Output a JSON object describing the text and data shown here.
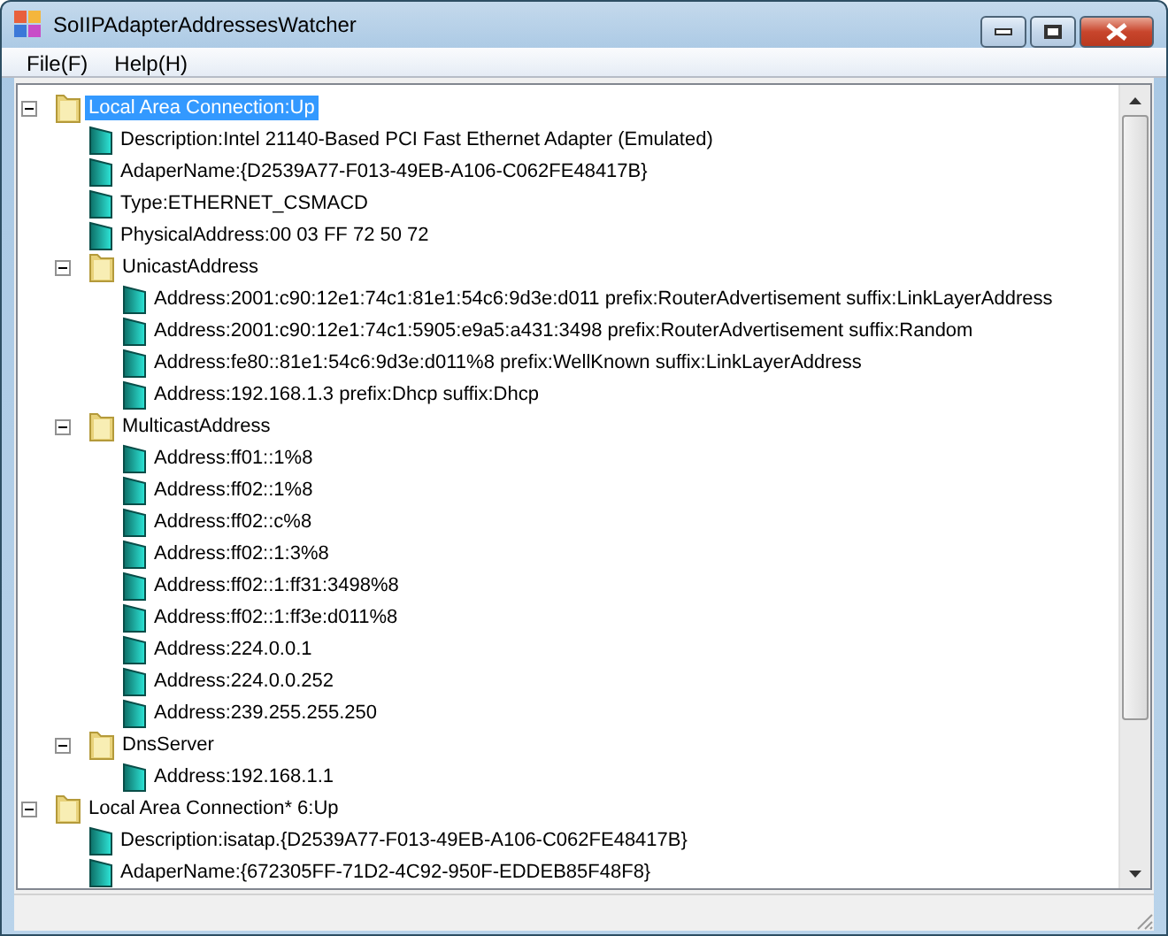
{
  "window": {
    "title": "SoIIPAdapterAddressesWatcher"
  },
  "menu": [
    "File(F)",
    "Help(H)"
  ],
  "tree": [
    {
      "kind": "folder",
      "label": "Local Area Connection:Up",
      "expanded": true,
      "selected": true,
      "children": [
        {
          "kind": "leaf",
          "label": "Description:Intel 21140-Based PCI Fast Ethernet Adapter (Emulated)"
        },
        {
          "kind": "leaf",
          "label": "AdaperName:{D2539A77-F013-49EB-A106-C062FE48417B}"
        },
        {
          "kind": "leaf",
          "label": "Type:ETHERNET_CSMACD"
        },
        {
          "kind": "leaf",
          "label": "PhysicalAddress:00 03 FF 72 50 72"
        },
        {
          "kind": "folder",
          "label": "UnicastAddress",
          "expanded": true,
          "selected": false,
          "children": [
            {
              "kind": "leaf",
              "label": "Address:2001:c90:12e1:74c1:81e1:54c6:9d3e:d011 prefix:RouterAdvertisement suffix:LinkLayerAddress"
            },
            {
              "kind": "leaf",
              "label": "Address:2001:c90:12e1:74c1:5905:e9a5:a431:3498 prefix:RouterAdvertisement suffix:Random"
            },
            {
              "kind": "leaf",
              "label": "Address:fe80::81e1:54c6:9d3e:d011%8 prefix:WellKnown suffix:LinkLayerAddress"
            },
            {
              "kind": "leaf",
              "label": "Address:192.168.1.3 prefix:Dhcp suffix:Dhcp"
            }
          ]
        },
        {
          "kind": "folder",
          "label": "MulticastAddress",
          "expanded": true,
          "selected": false,
          "children": [
            {
              "kind": "leaf",
              "label": "Address:ff01::1%8"
            },
            {
              "kind": "leaf",
              "label": "Address:ff02::1%8"
            },
            {
              "kind": "leaf",
              "label": "Address:ff02::c%8"
            },
            {
              "kind": "leaf",
              "label": "Address:ff02::1:3%8"
            },
            {
              "kind": "leaf",
              "label": "Address:ff02::1:ff31:3498%8"
            },
            {
              "kind": "leaf",
              "label": "Address:ff02::1:ff3e:d011%8"
            },
            {
              "kind": "leaf",
              "label": "Address:224.0.0.1"
            },
            {
              "kind": "leaf",
              "label": "Address:224.0.0.252"
            },
            {
              "kind": "leaf",
              "label": "Address:239.255.255.250"
            }
          ]
        },
        {
          "kind": "folder",
          "label": "DnsServer",
          "expanded": true,
          "selected": false,
          "children": [
            {
              "kind": "leaf",
              "label": "Address:192.168.1.1"
            }
          ]
        }
      ]
    },
    {
      "kind": "folder",
      "label": "Local Area Connection* 6:Up",
      "expanded": true,
      "selected": false,
      "children": [
        {
          "kind": "leaf",
          "label": "Description:isatap.{D2539A77-F013-49EB-A106-C062FE48417B}"
        },
        {
          "kind": "leaf",
          "label": "AdaperName:{672305FF-71D2-4C92-950F-EDDEB85F48F8}"
        }
      ]
    }
  ]
}
